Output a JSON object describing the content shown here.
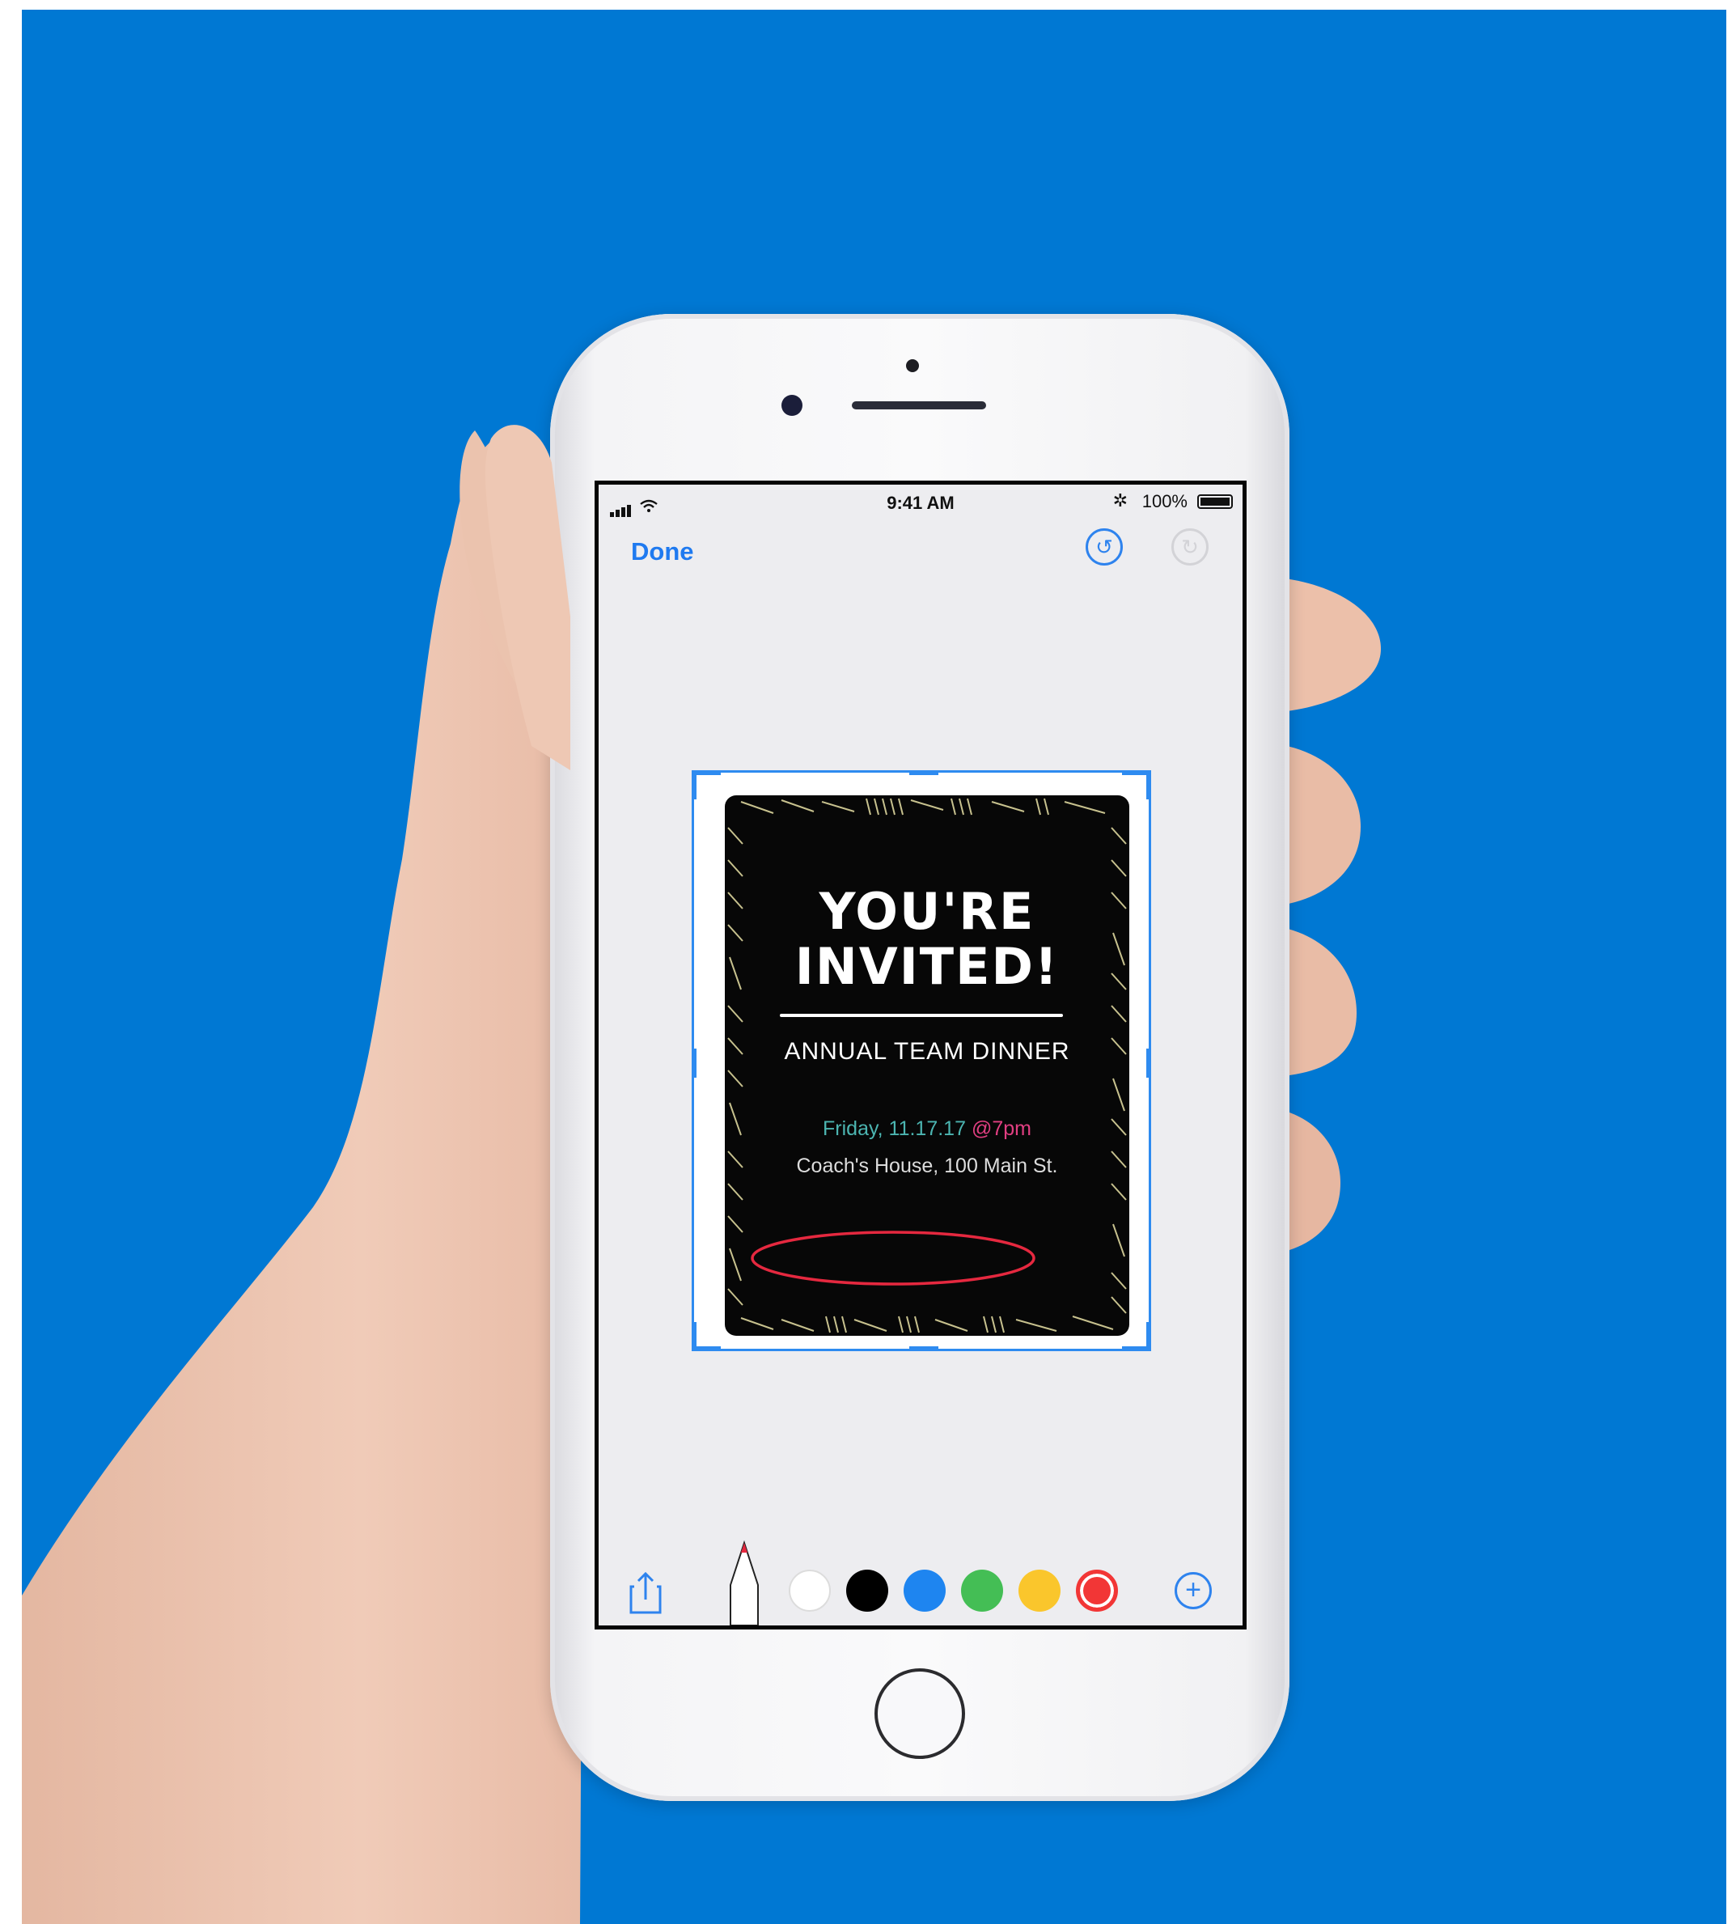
{
  "status_bar": {
    "time": "9:41 AM",
    "battery": "100%",
    "bluetooth_icon": "bluetooth-icon"
  },
  "toolbar": {
    "done_label": "Done",
    "undo_icon": "undo-icon",
    "redo_icon": "redo-icon"
  },
  "invitation": {
    "title_line1": "YOU'RE",
    "title_line2": "INVITED!",
    "event": "ANNUAL TEAM DINNER",
    "date": "Friday, 11.17.17",
    "time": "@7pm",
    "address": "Coach's House, 100 Main St."
  },
  "markup_tools": {
    "share_icon": "share-icon",
    "pen_icon": "pen-icon",
    "add_icon": "add-icon",
    "colors": [
      {
        "name": "white",
        "hex": "#FFFFFF"
      },
      {
        "name": "black",
        "hex": "#000000"
      },
      {
        "name": "blue",
        "hex": "#1E85F0"
      },
      {
        "name": "green",
        "hex": "#44BE55"
      },
      {
        "name": "yellow",
        "hex": "#FAC62C"
      },
      {
        "name": "red",
        "hex": "#F23636",
        "selected": true
      }
    ]
  },
  "colors": {
    "background": "#0078D3",
    "accent": "#1F7AF0",
    "annotation_stroke": "#E5283F"
  }
}
